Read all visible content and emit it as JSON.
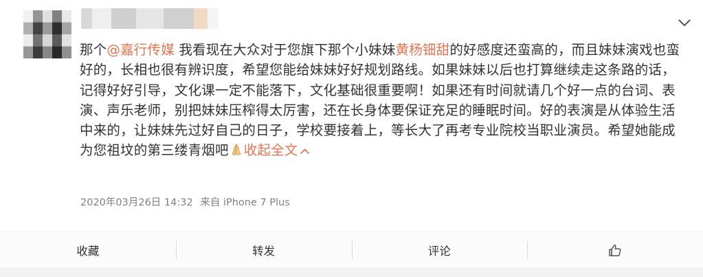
{
  "post": {
    "segments": {
      "s1": "那个",
      "mention": "@嘉行传媒",
      "s2": " 我看现在大众对于您旗下那个小妹妹",
      "celebrity": "黄杨钿甜",
      "s3": "的好感度还蛮高的，而且妹妹演戏也蛮好的，长相也很有辨识度，希望您能给妹妹好好规划路线。如果妹妹以后也打算继续走这条路的话，记得好好引导，文化课一定不能落下，文化基础很重要啊！如果还有时间就请几个好一点的台词、表演、声乐老师，别把妹妹压榨得太厉害，还在长身体要保证充足的睡眠时间。好的表演是从体验生活中来的，让妹妹先过好自己的日子，学校要接着上，等长大了再考专业院校当职业演员。希望她能成为您祖坟的第三缕青烟吧",
      "emoji": "praying-hands-icon",
      "collapse": "收起全文"
    },
    "timestamp": "2020年03月26日 14:32",
    "source": "来自 iPhone 7 Plus"
  },
  "actions": {
    "favorite": "收藏",
    "repost": "转发",
    "comment": "评论",
    "like_icon": "thumbs-up-icon"
  },
  "colors": {
    "link": "#eb7350",
    "text": "#333333",
    "meta": "#808080"
  }
}
